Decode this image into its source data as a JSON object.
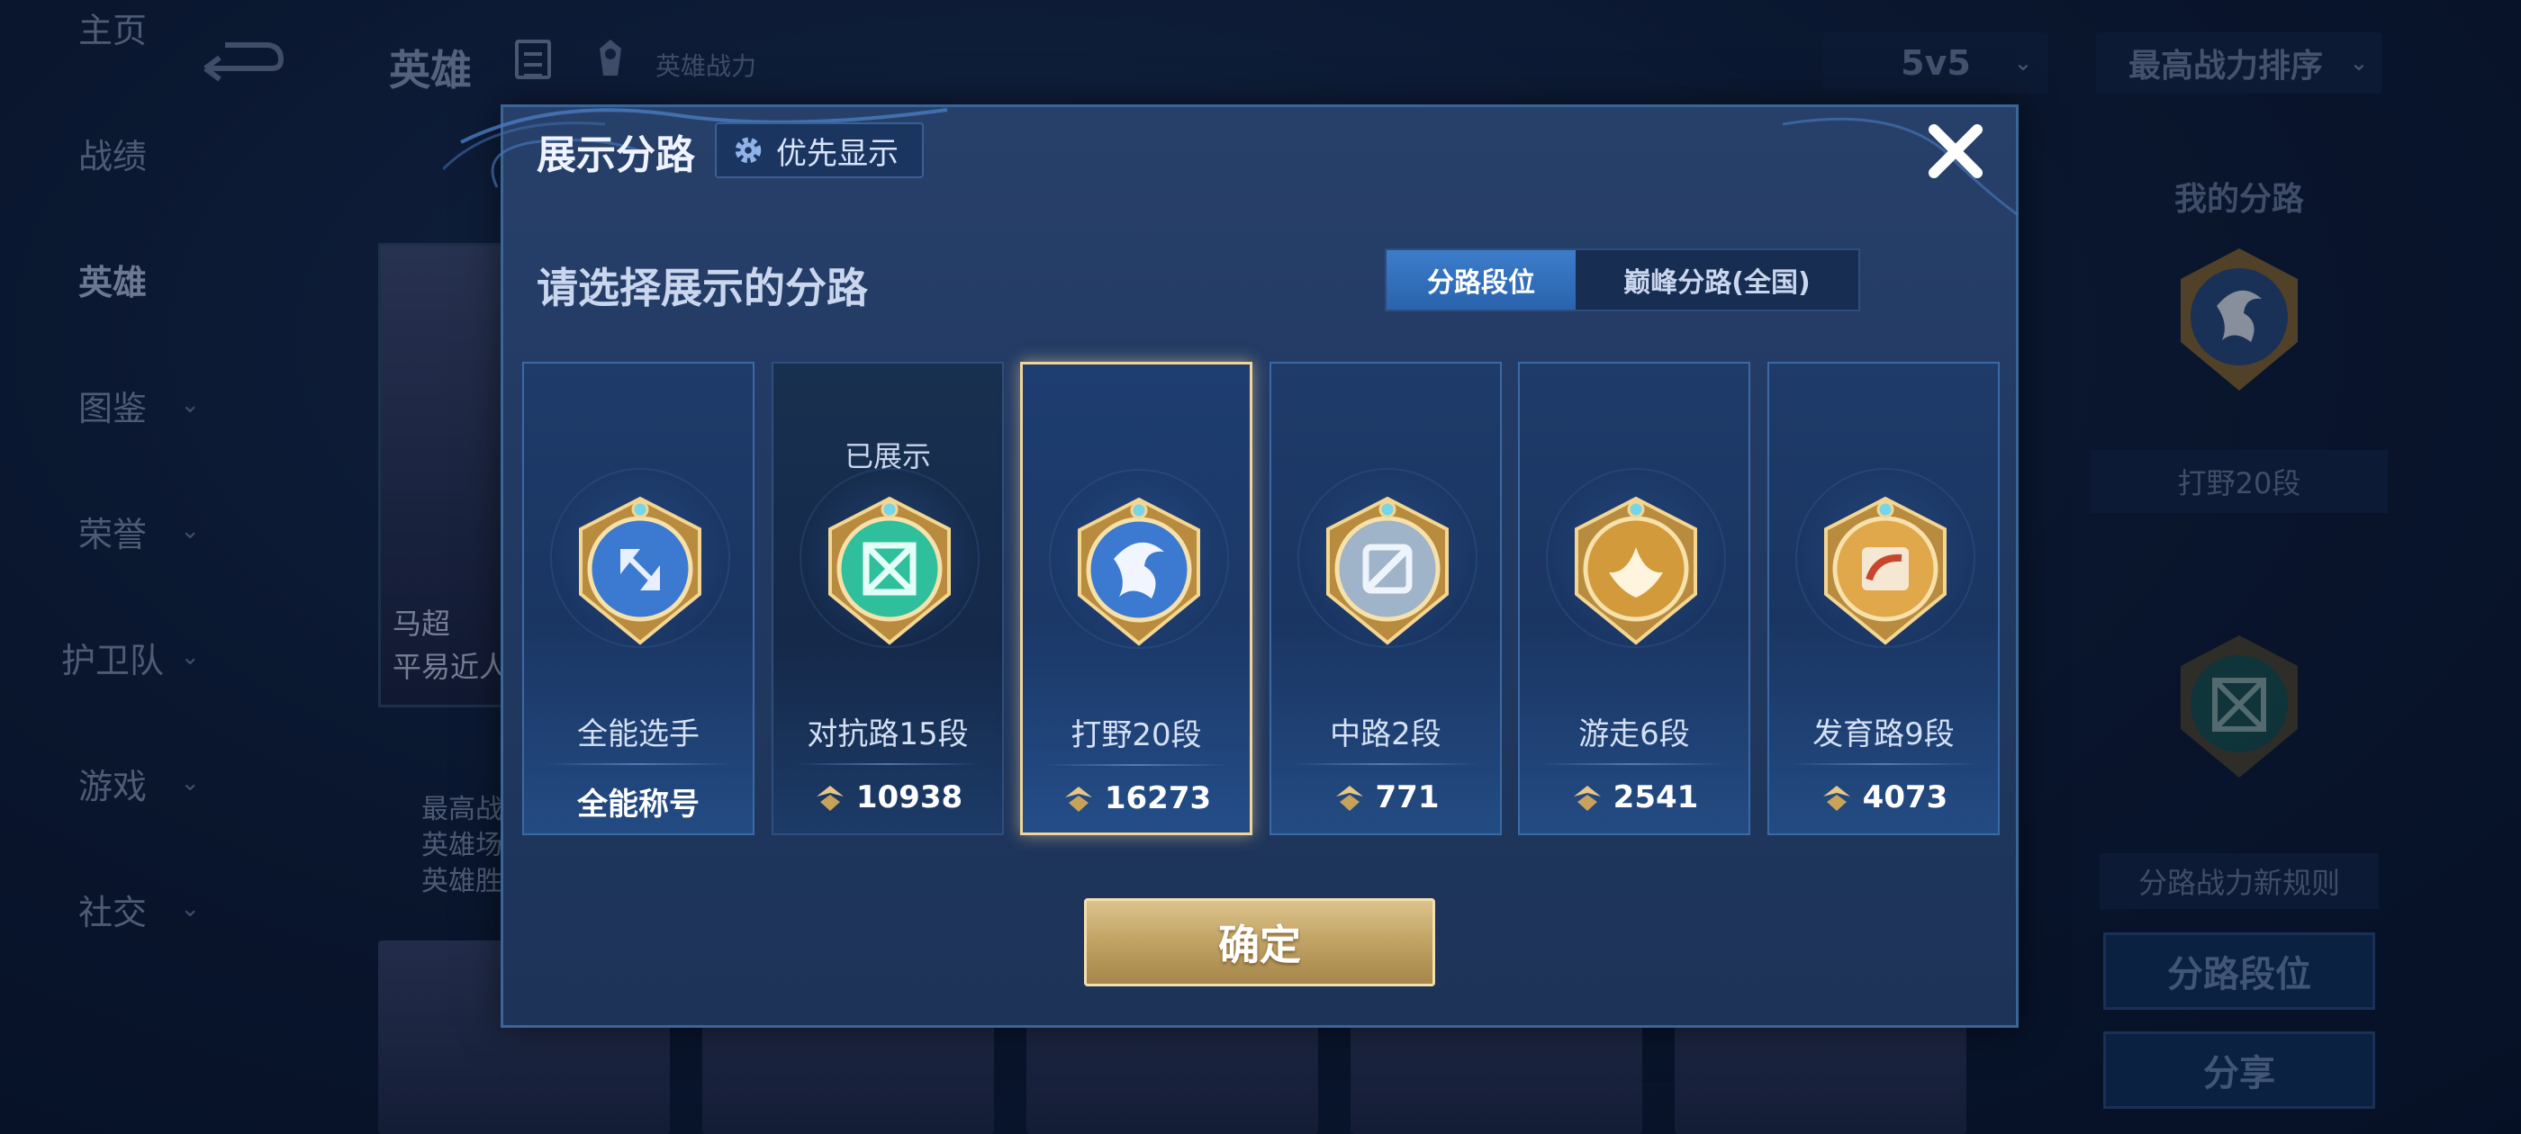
{
  "background": {
    "page_title": "英雄",
    "power_label": "英雄战力",
    "sidebar": [
      {
        "label": "主页",
        "has_chevron": false
      },
      {
        "label": "战绩",
        "has_chevron": false
      },
      {
        "label": "英雄",
        "has_chevron": false,
        "active": true
      },
      {
        "label": "图鉴",
        "has_chevron": true
      },
      {
        "label": "荣誉",
        "has_chevron": true
      },
      {
        "label": "护卫队",
        "has_chevron": true
      },
      {
        "label": "游戏",
        "has_chevron": true
      },
      {
        "label": "社交",
        "has_chevron": true
      }
    ],
    "mode_select": "5v5",
    "sort_select": "最高战力排序",
    "hero_card": {
      "name": "马超",
      "subtitle": "平易近人"
    },
    "hero_stats": [
      "最高战",
      "英雄场",
      "英雄胜"
    ],
    "right_panel": {
      "title": "我的分路",
      "rank": "打野20段",
      "rules": "分路战力新规则",
      "button_segment": "分路段位",
      "button_share": "分享"
    }
  },
  "modal": {
    "title": "展示分路",
    "priority_button": "优先显示",
    "prompt": "请选择展示的分路",
    "segmented": {
      "active": "分路段位",
      "inactive": "巅峰分路(全国)"
    },
    "cards": [
      {
        "rank": "全能选手",
        "value": "全能称号",
        "show_power_icon": false,
        "shown_label": "",
        "selected": false,
        "owned": false,
        "color": "#3b7ad0",
        "icon": "all-round-icon"
      },
      {
        "rank": "对抗路15段",
        "value": "10938",
        "show_power_icon": true,
        "shown_label": "已展示",
        "selected": false,
        "owned": true,
        "color": "#2fbf9c",
        "icon": "clash-lane-icon"
      },
      {
        "rank": "打野20段",
        "value": "16273",
        "show_power_icon": true,
        "shown_label": "",
        "selected": true,
        "owned": false,
        "color": "#3b7ad0",
        "icon": "jungle-dragon-icon"
      },
      {
        "rank": "中路2段",
        "value": "771",
        "show_power_icon": true,
        "shown_label": "",
        "selected": false,
        "owned": false,
        "color": "#9fb3c9",
        "icon": "mid-lane-icon"
      },
      {
        "rank": "游走6段",
        "value": "2541",
        "show_power_icon": true,
        "shown_label": "",
        "selected": false,
        "owned": false,
        "color": "#d29a3a",
        "icon": "roam-wings-icon"
      },
      {
        "rank": "发育路9段",
        "value": "4073",
        "show_power_icon": true,
        "shown_label": "",
        "selected": false,
        "owned": false,
        "color": "#e0a84a",
        "icon": "farm-lane-icon"
      }
    ],
    "confirm_button": "确定"
  }
}
